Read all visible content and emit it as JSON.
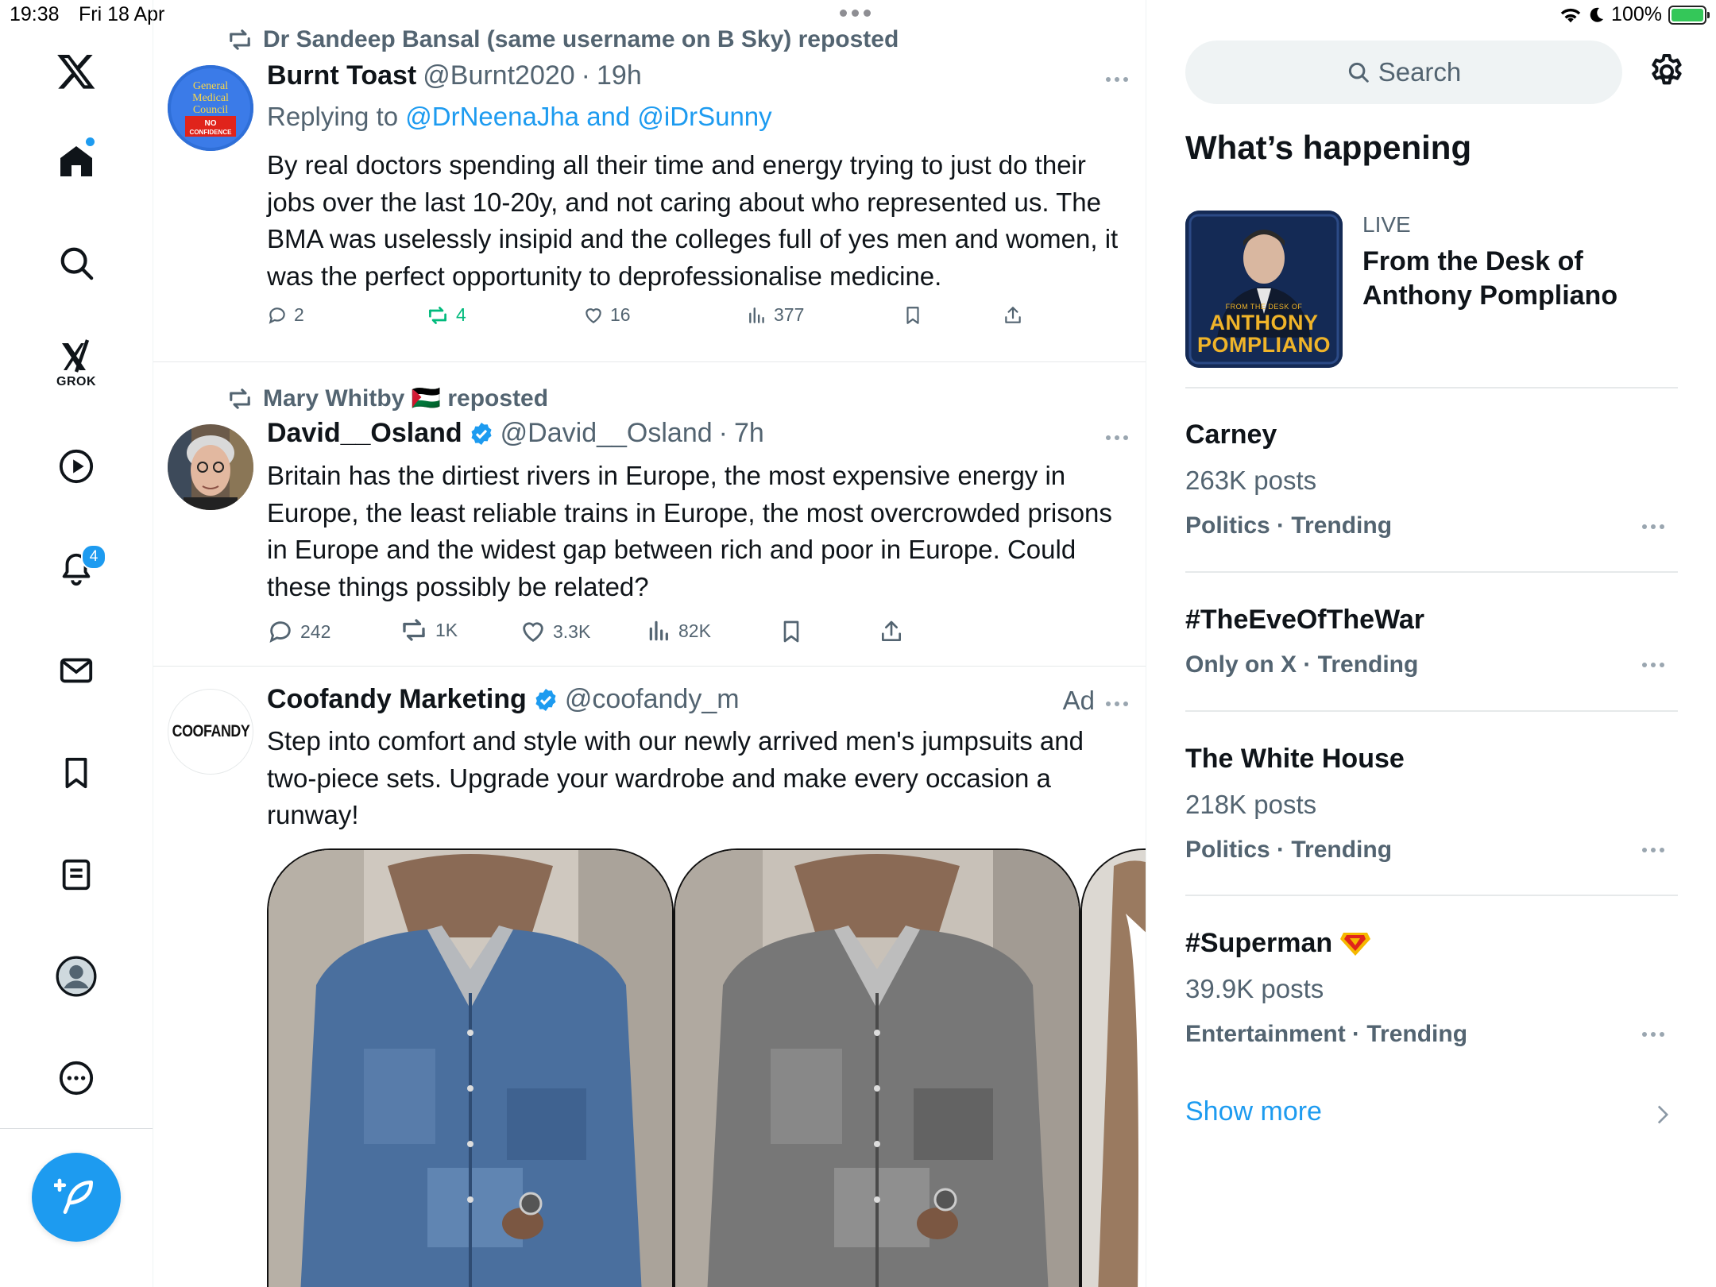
{
  "status_bar": {
    "time": "19:38",
    "date": "Fri 18 Apr",
    "battery": "100%"
  },
  "nav": {
    "grok_label": "GROK",
    "notifications_badge": "4"
  },
  "feed": {
    "tweets": [
      {
        "reposted_by": "Dr Sandeep Bansal (same username on B Sky) reposted",
        "name": "Burnt Toast",
        "handle": "@Burnt2020",
        "time": "19h",
        "replying_prefix": "Replying to ",
        "replying_to": "@DrNeenaJha and @iDrSunny",
        "text": "By real doctors spending all their time and energy trying to just do their jobs over the last 10-20y, and not caring about who represented us. The BMA was uselessly insipid and the colleges full of yes men and women, it was the perfect opportunity to deprofessionalise medicine.",
        "avatar_text": "General Medical Council NO CONFIDENCE",
        "replies": "2",
        "reposts": "4",
        "likes": "16",
        "views": "377"
      },
      {
        "reposted_by": "Mary Whitby 🇵🇸 reposted",
        "name": "David__Osland",
        "handle": "@David__Osland",
        "time": "7h",
        "text": "Britain has the dirtiest rivers in Europe, the most expensive energy in Europe, the least reliable trains in Europe, the most overcrowded prisons in Europe and the widest gap between rich and poor in Europe. Could these things possibly be related?",
        "replies": "242",
        "reposts": "1K",
        "likes": "3.3K",
        "views": "82K"
      },
      {
        "name": "Coofandy Marketing",
        "handle": "@coofandy_m",
        "ad_label": "Ad",
        "avatar_text": "COOFANDY",
        "text": "Step into comfort and style with our newly arrived men's jumpsuits and two-piece sets. Upgrade your wardrobe and make every occasion a runway!"
      }
    ]
  },
  "sidebar": {
    "search_placeholder": "Search",
    "heading": "What’s happening",
    "live": {
      "tag": "LIVE",
      "title": "From the Desk of Anthony Pompliano",
      "image_small_text": "FROM THE DESK OF",
      "image_line1": "ANTHONY",
      "image_line2": "POMPLIANO"
    },
    "trends": [
      {
        "title": "Carney",
        "count": "263K posts",
        "meta": "Politics · Trending"
      },
      {
        "title": "#TheEveOfTheWar",
        "meta": "Only on X · Trending"
      },
      {
        "title": "The White House",
        "count": "218K posts",
        "meta": "Politics · Trending"
      },
      {
        "title": "#Superman",
        "count": "39.9K posts",
        "meta": "Entertainment · Trending"
      }
    ],
    "show_more": "Show more"
  },
  "colors": {
    "accent": "#1d9bf0",
    "secondary_text": "#536471",
    "repost_green": "#00ba7c"
  }
}
